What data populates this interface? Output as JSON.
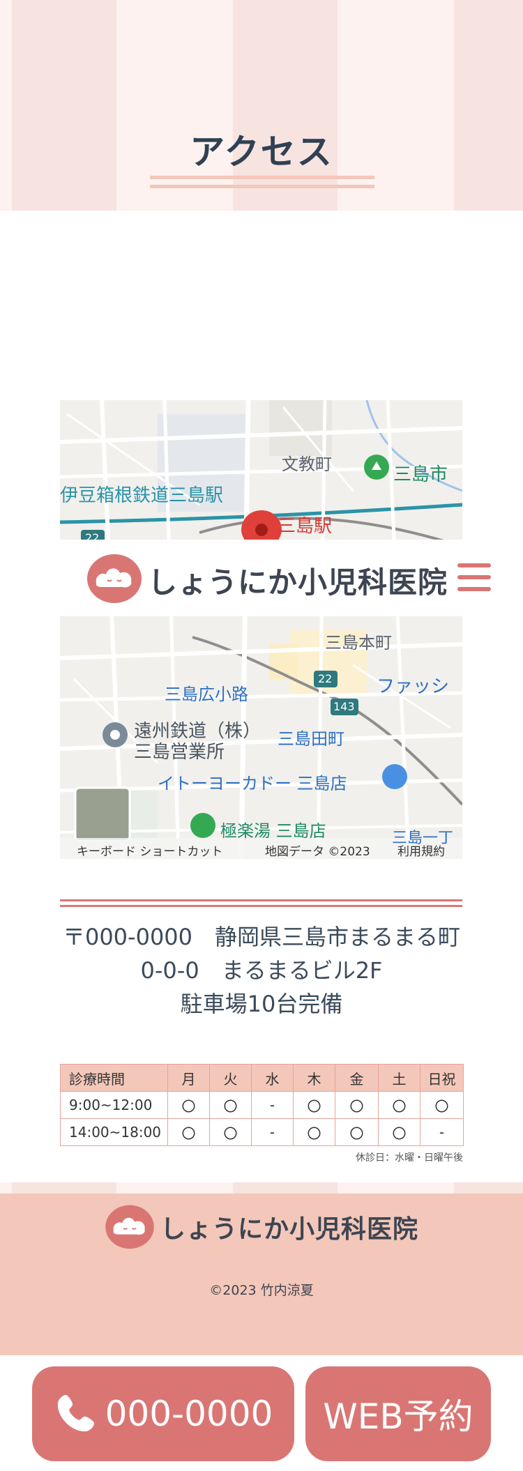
{
  "access": {
    "title": "アクセス"
  },
  "map": {
    "labels": {
      "bunkyo": "文教町",
      "mishima_city": "三島市",
      "izuhakone": "伊豆箱根鉄道三島駅",
      "mishima_station": "三島駅",
      "route22_top": "22",
      "mishima_hon": "三島本町",
      "route22": "22",
      "route143": "143",
      "hirokoji": "三島広小路",
      "fashion": "ファッシ",
      "enshu": "遠州鉄道（株）",
      "enshu_office": "三島営業所",
      "taamachi": "三島田町",
      "ito_yokado": "イトーヨーカドー 三島店",
      "gokuraku": "極楽湯 三島店",
      "mishima_ichi": "三島一丁"
    },
    "footer": {
      "shortcut": "キーボード ショートカット",
      "map_data": "地図データ ©2023",
      "terms": "利用規約"
    }
  },
  "header": {
    "logo_text": "しょうにか小児科医院"
  },
  "address": {
    "line1": "〒000-0000　静岡県三島市まるまる町",
    "line2": "0-0-0　まるまるビル2F",
    "line3": "駐車場10台完備"
  },
  "hours": {
    "columns": [
      "診療時間",
      "月",
      "火",
      "水",
      "木",
      "金",
      "土",
      "日祝"
    ],
    "rows": [
      [
        "9:00~12:00",
        "〇",
        "〇",
        "-",
        "〇",
        "〇",
        "〇",
        "〇"
      ],
      [
        "14:00~18:00",
        "〇",
        "〇",
        "-",
        "〇",
        "〇",
        "〇",
        "-"
      ]
    ],
    "note": "休診日：水曜・日曜午後"
  },
  "footer": {
    "logo_text": "しょうにか小児科医院",
    "copyright": "©2023 竹内涼夏"
  },
  "cta": {
    "tel_label": "000-0000",
    "web_label": "WEB予約"
  },
  "colors": {
    "accent": "#d97674",
    "footer_bg": "#f3c7b9",
    "stripe_light": "#fdf2ef",
    "stripe_dark": "#f7e3e0"
  },
  "icons": {
    "logo": "cloud-face-icon",
    "menu": "hamburger-menu-icon",
    "phone": "phone-icon",
    "map_pin": "map-pin-icon"
  }
}
